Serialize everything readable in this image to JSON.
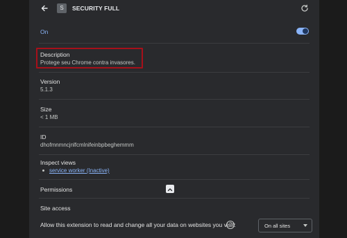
{
  "header": {
    "extension_initial": "S",
    "title": "SECURITY FULL"
  },
  "enabled": {
    "label": "On",
    "state": true
  },
  "description": {
    "heading": "Description",
    "text": "Protege seu Chrome contra invasores."
  },
  "version": {
    "heading": "Version",
    "value": "5.1.3"
  },
  "size": {
    "heading": "Size",
    "value": "< 1 MB"
  },
  "id": {
    "heading": "ID",
    "value": "dhofmnmncjnlfcmlnifeinbpbeghemmm"
  },
  "inspect_views": {
    "heading": "Inspect views",
    "link_text": "service worker (Inactive)"
  },
  "permissions": {
    "heading": "Permissions"
  },
  "site_access": {
    "heading": "Site access",
    "prompt": "Allow this extension to read and change all your data on websites you visit:",
    "selected_option": "On all sites"
  },
  "colors": {
    "accent": "#8ab4f8",
    "highlight_border": "#a7101a",
    "panel_bg": "#292a2d"
  }
}
